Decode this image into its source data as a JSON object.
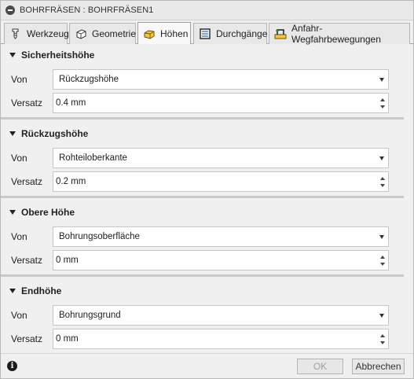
{
  "window": {
    "title": "BOHRFRÄSEN : BOHRFRÄSEN1"
  },
  "tabs": [
    {
      "label": "Werkzeug",
      "icon": "drill-tool-icon",
      "active": false
    },
    {
      "label": "Geometrie",
      "icon": "geometry-cube-icon",
      "active": false
    },
    {
      "label": "Höhen",
      "icon": "heights-block-icon",
      "active": true
    },
    {
      "label": "Durchgänge",
      "icon": "passes-icon",
      "active": false
    },
    {
      "label": "Anfahr-Wegfahrbewegungen",
      "icon": "linking-icon",
      "active": false
    }
  ],
  "sections": [
    {
      "title": "Sicherheitshöhe",
      "from_label": "Von",
      "from_value": "Rückzugshöhe",
      "offset_label": "Versatz",
      "offset_value": "0.4  mm"
    },
    {
      "title": "Rückzugshöhe",
      "from_label": "Von",
      "from_value": "Rohteiloberkante",
      "offset_label": "Versatz",
      "offset_value": "0.2 mm"
    },
    {
      "title": "Obere Höhe",
      "from_label": "Von",
      "from_value": "Bohrungsoberfläche",
      "offset_label": "Versatz",
      "offset_value": "0  mm"
    },
    {
      "title": "Endhöhe",
      "from_label": "Von",
      "from_value": "Bohrungsgrund",
      "offset_label": "Versatz",
      "offset_value": "0  mm"
    }
  ],
  "footer": {
    "ok_label": "OK",
    "cancel_label": "Abbrechen",
    "ok_enabled": false
  },
  "colors": {
    "background": "#f0f0f0",
    "separator": "#c9c9c9",
    "disabled_text": "#a0a0a0"
  }
}
